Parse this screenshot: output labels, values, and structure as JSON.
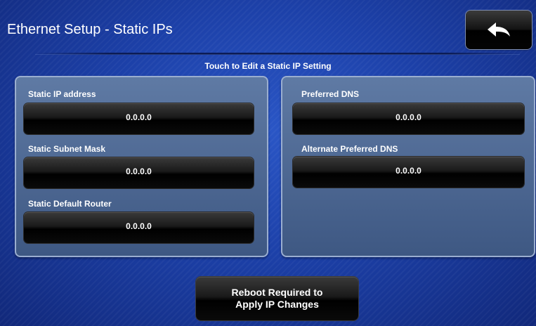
{
  "header": {
    "title": "Ethernet Setup - Static IPs",
    "back_icon": "back-arrow-icon",
    "subtitle": "Touch to Edit a Static IP Setting"
  },
  "left_panel": {
    "fields": [
      {
        "label": "Static IP address",
        "value": "0.0.0.0"
      },
      {
        "label": "Static Subnet Mask",
        "value": "0.0.0.0"
      },
      {
        "label": "Static Default Router",
        "value": "0.0.0.0"
      }
    ]
  },
  "right_panel": {
    "fields": [
      {
        "label": "Preferred DNS",
        "value": "0.0.0.0"
      },
      {
        "label": "Alternate Preferred DNS",
        "value": "0.0.0.0"
      }
    ]
  },
  "footer": {
    "reboot_line1": "Reboot Required to",
    "reboot_line2": "Apply IP Changes"
  },
  "colors": {
    "background": "#1c40a8",
    "panel": "#4f6a95",
    "button": "#000000",
    "text": "#ffffff"
  }
}
